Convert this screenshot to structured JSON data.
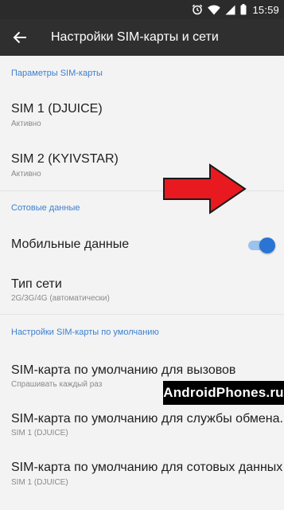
{
  "status_bar": {
    "time": "15:59",
    "icons": [
      "alarm-icon",
      "wifi-icon",
      "signal-icon",
      "battery-icon"
    ]
  },
  "app_bar": {
    "back_icon": "arrow-back-icon",
    "title": "Настройки SIM-карты и сети"
  },
  "sections": {
    "sim_params": {
      "header": "Параметры SIM-карты",
      "items": [
        {
          "title": "SIM 1  (DJUICE)",
          "subtitle": "Активно"
        },
        {
          "title": "SIM 2  (KYIVSTAR)",
          "subtitle": "Активно"
        }
      ]
    },
    "cellular": {
      "header": "Сотовые данные",
      "mobile_data": {
        "title": "Мобильные данные",
        "enabled": true
      },
      "network_type": {
        "title": "Тип сети",
        "subtitle": "2G/3G/4G (автоматически)"
      }
    },
    "defaults": {
      "header": "Настройки SIM-карты по умолчанию",
      "items": [
        {
          "title": "SIM-карта по умолчанию для вызовов",
          "subtitle": "Спрашивать каждый раз"
        },
        {
          "title": "SIM-карта по умолчанию для службы обмена...",
          "subtitle": "SIM 1 (DJUICE)"
        },
        {
          "title": "SIM-карта по умолчанию для сотовых данных",
          "subtitle": "SIM 1 (DJUICE)"
        }
      ]
    }
  },
  "annotation": {
    "arrow_color": "#e8191f",
    "watermark": "AndroidPhones.ru"
  },
  "colors": {
    "accent": "#3c7fd0",
    "toggle_on": "#2a74d3",
    "app_bar": "#2f2f2f",
    "status_bar": "#2b2b2b",
    "background": "#f3f3f3"
  }
}
